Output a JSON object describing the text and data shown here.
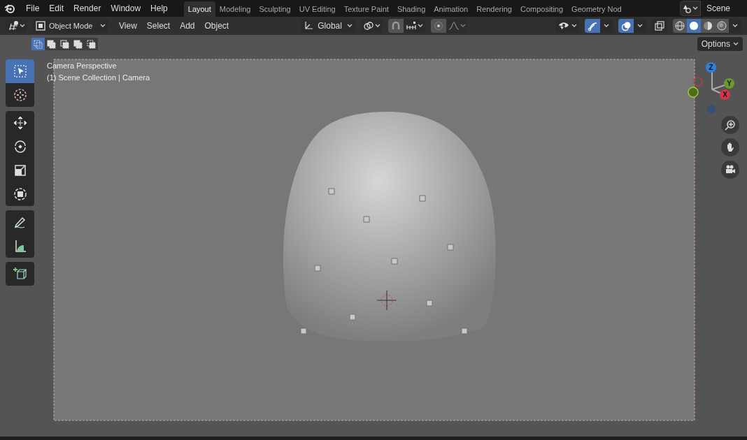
{
  "menus": [
    "File",
    "Edit",
    "Render",
    "Window",
    "Help"
  ],
  "workspaces": [
    {
      "label": "Layout",
      "selected": true
    },
    {
      "label": "Modeling",
      "selected": false
    },
    {
      "label": "Sculpting",
      "selected": false
    },
    {
      "label": "UV Editing",
      "selected": false
    },
    {
      "label": "Texture Paint",
      "selected": false
    },
    {
      "label": "Shading",
      "selected": false
    },
    {
      "label": "Animation",
      "selected": false
    },
    {
      "label": "Rendering",
      "selected": false
    },
    {
      "label": "Compositing",
      "selected": false
    },
    {
      "label": "Geometry Nod",
      "selected": false
    }
  ],
  "scene": {
    "value": "Scene"
  },
  "header": {
    "mode": "Object Mode",
    "menus": [
      "View",
      "Select",
      "Add",
      "Object"
    ],
    "orientation": "Global",
    "snap_on": false,
    "proportional_on": false,
    "gizmos_on": true,
    "overlays_on": true,
    "xray_on": false
  },
  "shading_modes": [
    {
      "selected": false
    },
    {
      "selected": true
    },
    {
      "selected": false
    },
    {
      "selected": false
    }
  ],
  "select_modes": [
    {
      "selected": true
    },
    {
      "selected": false
    },
    {
      "selected": false
    },
    {
      "selected": false
    },
    {
      "selected": false
    }
  ],
  "options_label": "Options",
  "viewport": {
    "title": "Camera Perspective",
    "subtitle": "(1) Scene Collection | Camera"
  },
  "tool_groups": [
    [
      {
        "selected": true
      },
      {
        "selected": false
      }
    ],
    [
      {
        "selected": false
      },
      {
        "selected": false
      },
      {
        "selected": false
      },
      {
        "selected": false
      }
    ],
    [
      {
        "selected": false
      },
      {
        "selected": false
      }
    ],
    [
      {
        "selected": false
      }
    ]
  ],
  "gizmo_axes": [
    "Z",
    "Y",
    "X"
  ]
}
